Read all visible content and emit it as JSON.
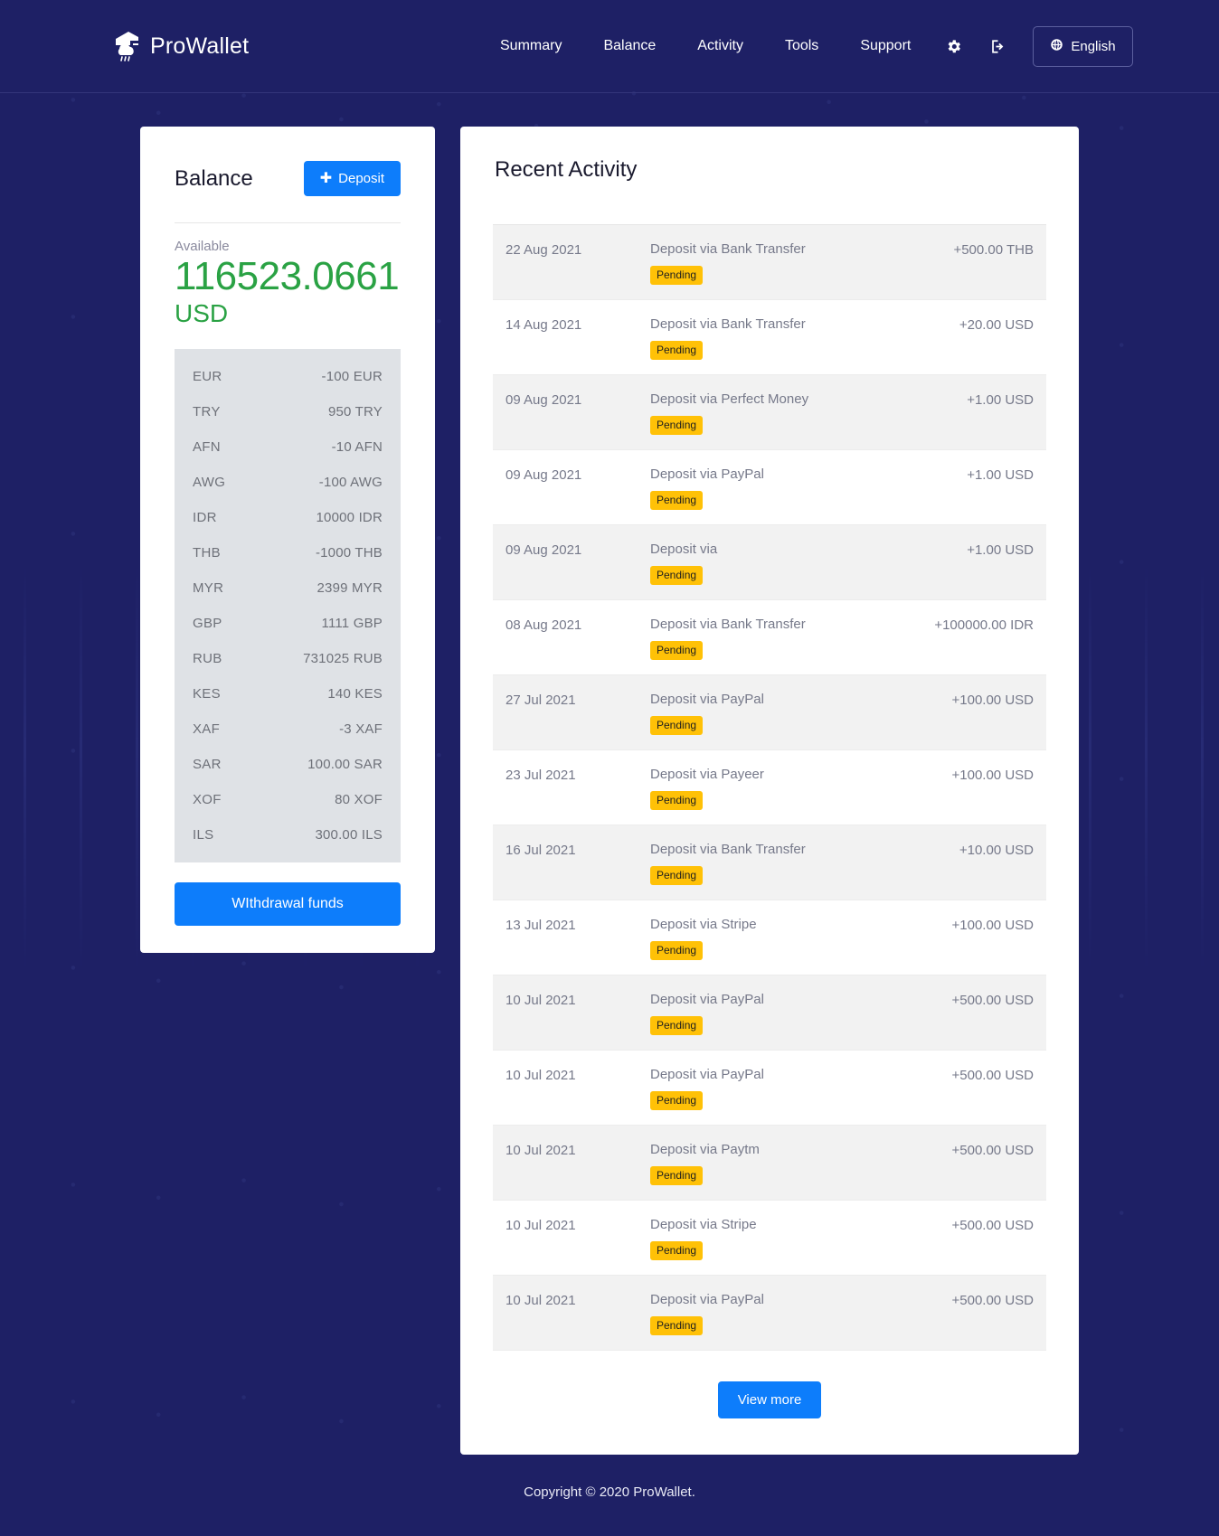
{
  "header": {
    "brand": "ProWallet",
    "nav": [
      {
        "label": "Summary"
      },
      {
        "label": "Balance"
      },
      {
        "label": "Activity"
      },
      {
        "label": "Tools"
      },
      {
        "label": "Support"
      }
    ],
    "settings_icon": "gear-icon",
    "logout_icon": "logout-icon",
    "language": {
      "label": "English",
      "icon": "globe-icon"
    }
  },
  "balance": {
    "title": "Balance",
    "deposit_label": "Deposit",
    "deposit_icon": "plus-icon",
    "available_label": "Available",
    "available_amount": "116523.0661",
    "available_currency": "USD",
    "withdraw_label": "WIthdrawal funds",
    "currencies": [
      {
        "code": "EUR",
        "value": "-100 EUR"
      },
      {
        "code": "TRY",
        "value": "950 TRY"
      },
      {
        "code": "AFN",
        "value": "-10 AFN"
      },
      {
        "code": "AWG",
        "value": "-100 AWG"
      },
      {
        "code": "IDR",
        "value": "10000 IDR"
      },
      {
        "code": "THB",
        "value": "-1000 THB"
      },
      {
        "code": "MYR",
        "value": "2399 MYR"
      },
      {
        "code": "GBP",
        "value": "1111 GBP"
      },
      {
        "code": "RUB",
        "value": "731025 RUB"
      },
      {
        "code": "KES",
        "value": "140 KES"
      },
      {
        "code": "XAF",
        "value": "-3 XAF"
      },
      {
        "code": "SAR",
        "value": "100.00 SAR"
      },
      {
        "code": "XOF",
        "value": "80 XOF"
      },
      {
        "code": "ILS",
        "value": "300.00 ILS"
      }
    ]
  },
  "activity": {
    "title": "Recent Activity",
    "view_more_label": "View more",
    "rows": [
      {
        "date": "22 Aug 2021",
        "description": "Deposit via Bank Transfer",
        "status": "Pending",
        "amount": "+500.00 THB"
      },
      {
        "date": "14 Aug 2021",
        "description": "Deposit via Bank Transfer",
        "status": "Pending",
        "amount": "+20.00 USD"
      },
      {
        "date": "09 Aug 2021",
        "description": "Deposit via Perfect Money",
        "status": "Pending",
        "amount": "+1.00 USD"
      },
      {
        "date": "09 Aug 2021",
        "description": "Deposit via PayPal",
        "status": "Pending",
        "amount": "+1.00 USD"
      },
      {
        "date": "09 Aug 2021",
        "description": "Deposit via",
        "status": "Pending",
        "amount": "+1.00 USD"
      },
      {
        "date": "08 Aug 2021",
        "description": "Deposit via Bank Transfer",
        "status": "Pending",
        "amount": "+100000.00 IDR"
      },
      {
        "date": "27 Jul 2021",
        "description": "Deposit via PayPal",
        "status": "Pending",
        "amount": "+100.00 USD"
      },
      {
        "date": "23 Jul 2021",
        "description": "Deposit via Payeer",
        "status": "Pending",
        "amount": "+100.00 USD"
      },
      {
        "date": "16 Jul 2021",
        "description": "Deposit via Bank Transfer",
        "status": "Pending",
        "amount": "+10.00 USD"
      },
      {
        "date": "13 Jul 2021",
        "description": "Deposit via Stripe",
        "status": "Pending",
        "amount": "+100.00 USD"
      },
      {
        "date": "10 Jul 2021",
        "description": "Deposit via PayPal",
        "status": "Pending",
        "amount": "+500.00 USD"
      },
      {
        "date": "10 Jul 2021",
        "description": "Deposit via PayPal",
        "status": "Pending",
        "amount": "+500.00 USD"
      },
      {
        "date": "10 Jul 2021",
        "description": "Deposit via Paytm",
        "status": "Pending",
        "amount": "+500.00 USD"
      },
      {
        "date": "10 Jul 2021",
        "description": "Deposit via Stripe",
        "status": "Pending",
        "amount": "+500.00 USD"
      },
      {
        "date": "10 Jul 2021",
        "description": "Deposit via PayPal",
        "status": "Pending",
        "amount": "+500.00 USD"
      }
    ]
  },
  "footer": {
    "copyright": "Copyright © 2020 ProWallet."
  },
  "colors": {
    "page_background": "#1e2065",
    "accent_blue": "#0d7dfb",
    "balance_green": "#2aa244",
    "badge_yellow": "#ffc107",
    "zebra_row": "#f2f2f2",
    "currency_panel": "#dfe2e6"
  }
}
